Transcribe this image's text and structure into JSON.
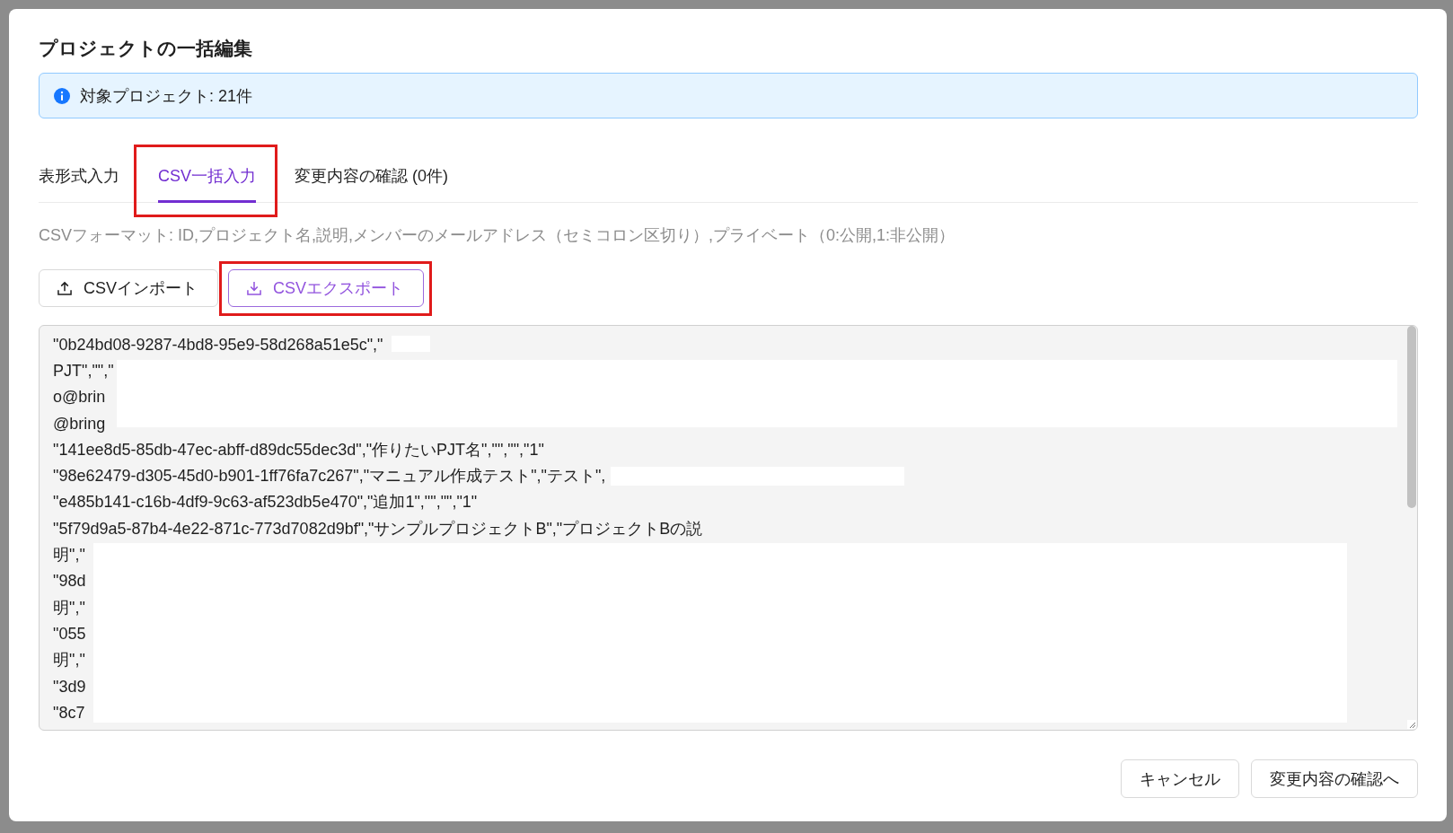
{
  "dialog": {
    "title": "プロジェクトの一括編集"
  },
  "alert": {
    "kind": "info",
    "text": "対象プロジェクト: 21件"
  },
  "tabs": [
    {
      "label": "表形式入力",
      "selected": false,
      "highlighted": false
    },
    {
      "label": "CSV一括入力",
      "selected": true,
      "highlighted": true
    },
    {
      "label": "変更内容の確認 (0件)",
      "selected": false,
      "highlighted": false
    }
  ],
  "format_hint": "CSVフォーマット: ID,プロジェクト名,説明,メンバーのメールアドレス（セミコロン区切り）,プライベート（0:公開,1:非公開）",
  "actions": [
    {
      "kind": "import",
      "label": "CSVインポート",
      "focused": false,
      "highlighted": false
    },
    {
      "kind": "export",
      "label": "CSVエクスポート",
      "focused": true,
      "highlighted": true
    }
  ],
  "csv_editor": {
    "lines": [
      "\"0b24bd08-9287-4bd8-95e9-58d268a51e5c\",\"",
      "PJT\",\"\",\"",
      "o@brin",
      "@bring",
      "\"141ee8d5-85db-47ec-abff-d89dc55dec3d\",\"作りたいPJT名\",\"\",\"\",\"1\"",
      "\"98e62479-d305-45d0-b901-1ff76fa7c267\",\"マニュアル作成テスト\",\"テスト\",",
      "\"e485b141-c16b-4df9-9c63-af523db5e470\",\"追加1\",\"\",\"\",\"1\"",
      "\"5f79d9a5-87b4-4e22-871c-773d7082d9bf\",\"サンプルプロジェクトB\",\"プロジェクトBの説",
      "明\",\"",
      "\"98d",
      "明\",\"",
      "\"055",
      "明\",\"",
      "\"3d9",
      "\"8c7"
    ]
  },
  "footer_buttons": [
    {
      "label": "キャンセル"
    },
    {
      "label": "変更内容の確認へ"
    }
  ]
}
